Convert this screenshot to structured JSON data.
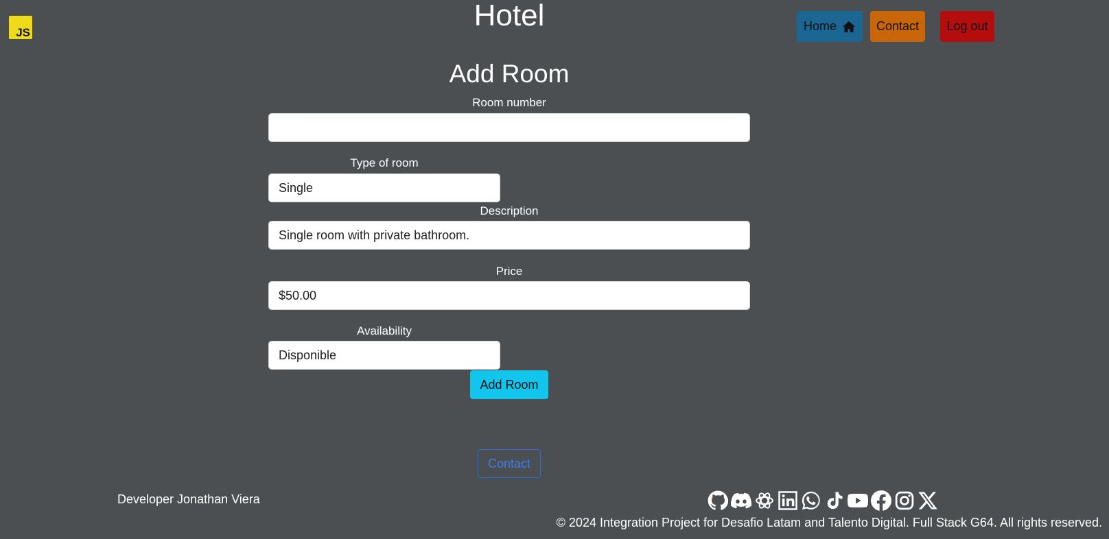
{
  "header": {
    "logo_text": "JS",
    "title": "Hotel",
    "nav": {
      "home_label": "Home",
      "contact_label": "Contact",
      "logout_label": "Log out"
    }
  },
  "form": {
    "title": "Add Room",
    "room_number": {
      "label": "Room number",
      "value": ""
    },
    "room_type": {
      "label": "Type of room",
      "value": "Single"
    },
    "description": {
      "label": "Description",
      "value": "Single room with private bathroom."
    },
    "price": {
      "label": "Price",
      "value": "$50.00"
    },
    "availability": {
      "label": "Availability",
      "value": "Disponible"
    },
    "submit_label": "Add Room"
  },
  "footer": {
    "contact_label": "Contact",
    "developer": "Developer Jonathan Viera",
    "socials": [
      "github-icon",
      "discord-icon",
      "openai-icon",
      "linkedin-icon",
      "whatsapp-icon",
      "tiktok-icon",
      "youtube-icon",
      "facebook-icon",
      "instagram-icon",
      "x-icon"
    ],
    "copyright": "© 2024 Integration Project for Desafio Latam and Talento Digital. Full Stack G64. All rights reserved."
  },
  "colors": {
    "background": "#4c4f51",
    "home": "#1c6694",
    "contact": "#c9660a",
    "logout": "#b30d0d",
    "submit": "#11c5ec",
    "footer_contact": "#3d7df0"
  }
}
